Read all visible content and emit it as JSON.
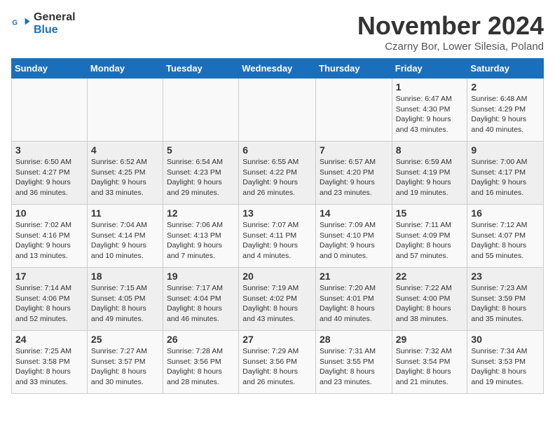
{
  "logo": {
    "line1": "General",
    "line2": "Blue"
  },
  "title": "November 2024",
  "subtitle": "Czarny Bor, Lower Silesia, Poland",
  "weekdays": [
    "Sunday",
    "Monday",
    "Tuesday",
    "Wednesday",
    "Thursday",
    "Friday",
    "Saturday"
  ],
  "weeks": [
    [
      {
        "day": "",
        "info": ""
      },
      {
        "day": "",
        "info": ""
      },
      {
        "day": "",
        "info": ""
      },
      {
        "day": "",
        "info": ""
      },
      {
        "day": "",
        "info": ""
      },
      {
        "day": "1",
        "info": "Sunrise: 6:47 AM\nSunset: 4:30 PM\nDaylight: 9 hours\nand 43 minutes."
      },
      {
        "day": "2",
        "info": "Sunrise: 6:48 AM\nSunset: 4:29 PM\nDaylight: 9 hours\nand 40 minutes."
      }
    ],
    [
      {
        "day": "3",
        "info": "Sunrise: 6:50 AM\nSunset: 4:27 PM\nDaylight: 9 hours\nand 36 minutes."
      },
      {
        "day": "4",
        "info": "Sunrise: 6:52 AM\nSunset: 4:25 PM\nDaylight: 9 hours\nand 33 minutes."
      },
      {
        "day": "5",
        "info": "Sunrise: 6:54 AM\nSunset: 4:23 PM\nDaylight: 9 hours\nand 29 minutes."
      },
      {
        "day": "6",
        "info": "Sunrise: 6:55 AM\nSunset: 4:22 PM\nDaylight: 9 hours\nand 26 minutes."
      },
      {
        "day": "7",
        "info": "Sunrise: 6:57 AM\nSunset: 4:20 PM\nDaylight: 9 hours\nand 23 minutes."
      },
      {
        "day": "8",
        "info": "Sunrise: 6:59 AM\nSunset: 4:19 PM\nDaylight: 9 hours\nand 19 minutes."
      },
      {
        "day": "9",
        "info": "Sunrise: 7:00 AM\nSunset: 4:17 PM\nDaylight: 9 hours\nand 16 minutes."
      }
    ],
    [
      {
        "day": "10",
        "info": "Sunrise: 7:02 AM\nSunset: 4:16 PM\nDaylight: 9 hours\nand 13 minutes."
      },
      {
        "day": "11",
        "info": "Sunrise: 7:04 AM\nSunset: 4:14 PM\nDaylight: 9 hours\nand 10 minutes."
      },
      {
        "day": "12",
        "info": "Sunrise: 7:06 AM\nSunset: 4:13 PM\nDaylight: 9 hours\nand 7 minutes."
      },
      {
        "day": "13",
        "info": "Sunrise: 7:07 AM\nSunset: 4:11 PM\nDaylight: 9 hours\nand 4 minutes."
      },
      {
        "day": "14",
        "info": "Sunrise: 7:09 AM\nSunset: 4:10 PM\nDaylight: 9 hours\nand 0 minutes."
      },
      {
        "day": "15",
        "info": "Sunrise: 7:11 AM\nSunset: 4:09 PM\nDaylight: 8 hours\nand 57 minutes."
      },
      {
        "day": "16",
        "info": "Sunrise: 7:12 AM\nSunset: 4:07 PM\nDaylight: 8 hours\nand 55 minutes."
      }
    ],
    [
      {
        "day": "17",
        "info": "Sunrise: 7:14 AM\nSunset: 4:06 PM\nDaylight: 8 hours\nand 52 minutes."
      },
      {
        "day": "18",
        "info": "Sunrise: 7:15 AM\nSunset: 4:05 PM\nDaylight: 8 hours\nand 49 minutes."
      },
      {
        "day": "19",
        "info": "Sunrise: 7:17 AM\nSunset: 4:04 PM\nDaylight: 8 hours\nand 46 minutes."
      },
      {
        "day": "20",
        "info": "Sunrise: 7:19 AM\nSunset: 4:02 PM\nDaylight: 8 hours\nand 43 minutes."
      },
      {
        "day": "21",
        "info": "Sunrise: 7:20 AM\nSunset: 4:01 PM\nDaylight: 8 hours\nand 40 minutes."
      },
      {
        "day": "22",
        "info": "Sunrise: 7:22 AM\nSunset: 4:00 PM\nDaylight: 8 hours\nand 38 minutes."
      },
      {
        "day": "23",
        "info": "Sunrise: 7:23 AM\nSunset: 3:59 PM\nDaylight: 8 hours\nand 35 minutes."
      }
    ],
    [
      {
        "day": "24",
        "info": "Sunrise: 7:25 AM\nSunset: 3:58 PM\nDaylight: 8 hours\nand 33 minutes."
      },
      {
        "day": "25",
        "info": "Sunrise: 7:27 AM\nSunset: 3:57 PM\nDaylight: 8 hours\nand 30 minutes."
      },
      {
        "day": "26",
        "info": "Sunrise: 7:28 AM\nSunset: 3:56 PM\nDaylight: 8 hours\nand 28 minutes."
      },
      {
        "day": "27",
        "info": "Sunrise: 7:29 AM\nSunset: 3:56 PM\nDaylight: 8 hours\nand 26 minutes."
      },
      {
        "day": "28",
        "info": "Sunrise: 7:31 AM\nSunset: 3:55 PM\nDaylight: 8 hours\nand 23 minutes."
      },
      {
        "day": "29",
        "info": "Sunrise: 7:32 AM\nSunset: 3:54 PM\nDaylight: 8 hours\nand 21 minutes."
      },
      {
        "day": "30",
        "info": "Sunrise: 7:34 AM\nSunset: 3:53 PM\nDaylight: 8 hours\nand 19 minutes."
      }
    ]
  ]
}
